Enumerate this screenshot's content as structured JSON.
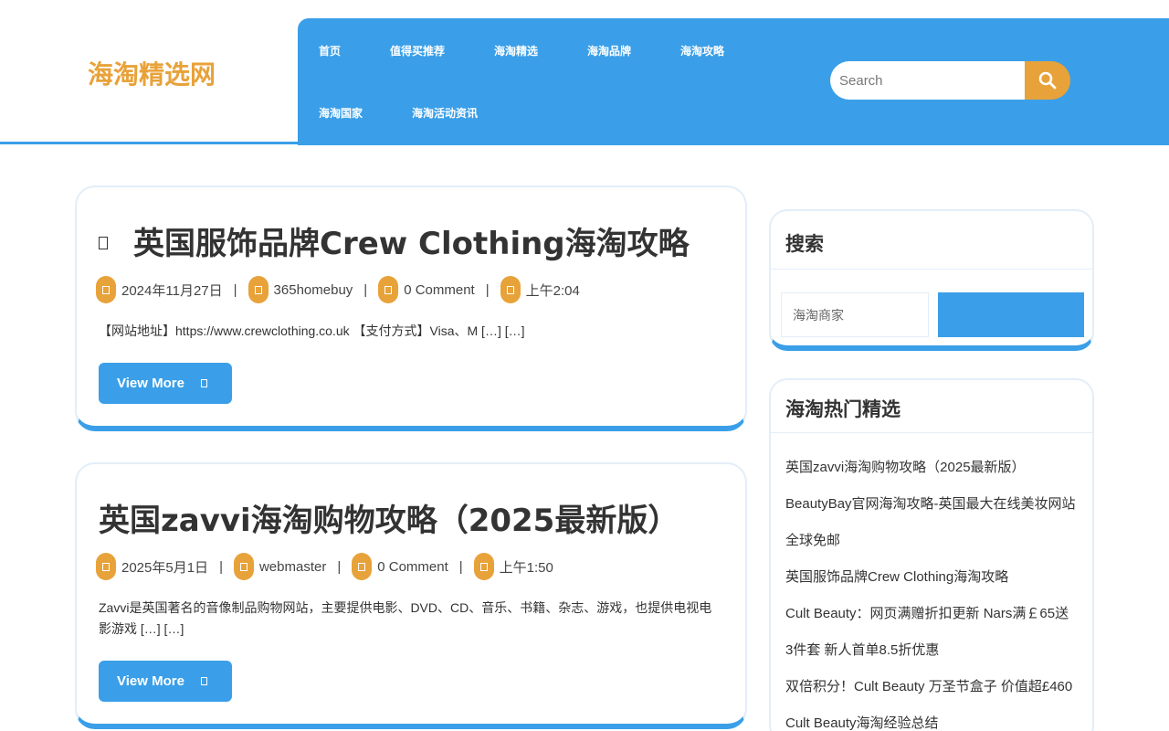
{
  "site": {
    "brand": "海淘精选网"
  },
  "nav": {
    "items": [
      "首页",
      "值得买推荐",
      "海淘精选",
      "海淘品牌",
      "海淘攻略",
      "海淘国家",
      "海淘活动资讯"
    ]
  },
  "search": {
    "placeholder": "Search"
  },
  "posts": [
    {
      "title": "英国服饰品牌Crew Clothing海淘攻略",
      "date": "2024年11月27日",
      "author": "365homebuy",
      "comments": "0 Comment",
      "time": "上午2:04",
      "excerpt": "【网站地址】https://www.crewclothing.co.uk  【支付方式】Visa、M […] […]",
      "button": "View More"
    },
    {
      "title": "英国zavvi海淘购物攻略（2025最新版）",
      "date": "2025年5月1日",
      "author": "webmaster",
      "comments": "0 Comment",
      "time": "上午1:50",
      "excerpt": "Zavvi是英国著名的音像制品购物网站，主要提供电影、DVD、CD、音乐、书籍、杂志、游戏，也提供电视电影游戏 […] […]",
      "button": "View More"
    }
  ],
  "sidebar": {
    "search_widget": {
      "title": "搜索",
      "placeholder": "海淘商家"
    },
    "hot_widget": {
      "title": "海淘热门精选",
      "items": [
        "英国zavvi海淘购物攻略（2025最新版）",
        "BeautyBay官网海淘攻略-英国最大在线美妆网站",
        "全球免邮",
        "英国服饰品牌Crew Clothing海淘攻略",
        "Cult Beauty：网页满赠折扣更新 Nars满￡65送",
        "3件套 新人首单8.5折优惠",
        "双倍积分！Cult Beauty 万圣节盒子 价值超£460",
        "Cult Beauty海淘经验总结"
      ]
    }
  },
  "colors": {
    "primary": "#3a9fe8",
    "accent": "#e8a23a"
  },
  "icons": {
    "search": "search-icon",
    "meta": "meta-icon",
    "arrow": "arrow-icon",
    "pin": "pin-icon"
  }
}
